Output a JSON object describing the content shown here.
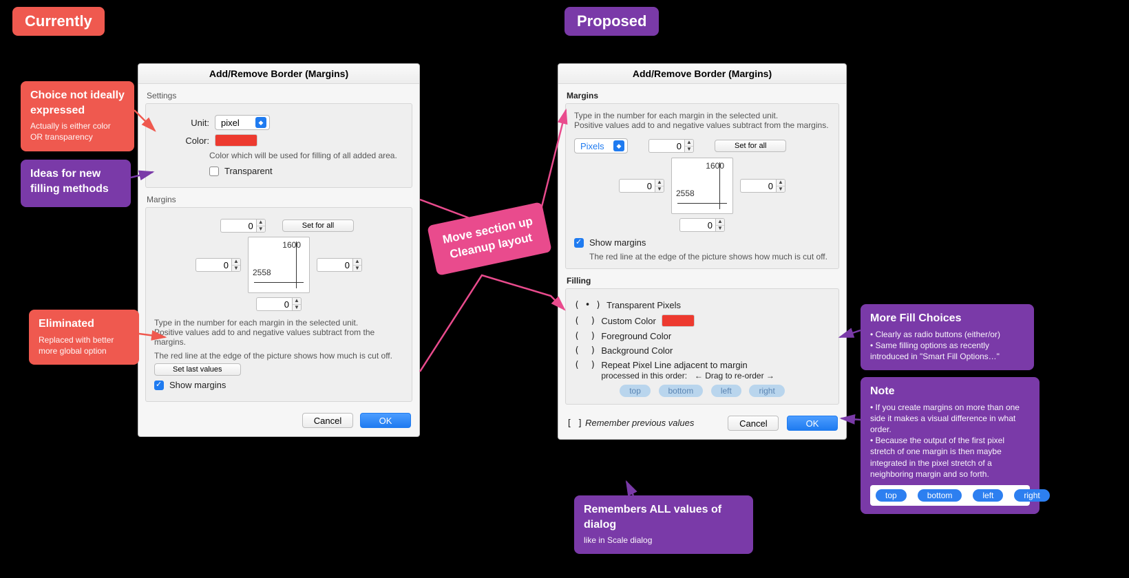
{
  "headlines": {
    "currently": "Currently",
    "proposed": "Proposed"
  },
  "callouts": {
    "choice": {
      "hd": "Choice not ideally expressed",
      "sub": "Actually is either color OR transparency"
    },
    "ideas": {
      "hd": "Ideas for new filling methods"
    },
    "eliminated": {
      "hd": "Eliminated",
      "sub": "Replaced with better more global option"
    },
    "move": {
      "l1": "Move section up",
      "l2": "Cleanup layout"
    },
    "morefill": {
      "hd": "More Fill Choices",
      "b1": "• Clearly as radio buttons (either/or)",
      "b2": "• Same filling options as recently",
      "b3": "  introduced in \"Smart Fill Options…\""
    },
    "note": {
      "hd": "Note",
      "p1": "• If you create margins on more than one side it makes a visual difference in what order.",
      "p2": "• Because the output of the first pixel stretch of one margin is then maybe integrated in the pixel stretch of a neighboring margin and so forth.",
      "chips": [
        "top",
        "bottom",
        "left",
        "right"
      ]
    },
    "remembers": {
      "hd": "Remembers ALL values of dialog",
      "sub": "like in Scale dialog"
    }
  },
  "current": {
    "title": "Add/Remove Border (Margins)",
    "settings_label": "Settings",
    "unit_label": "Unit:",
    "unit_value": "pixel",
    "color_label": "Color:",
    "color_help": "Color which will be used for filling of all added area.",
    "transparent": "Transparent",
    "margins_label": "Margins",
    "set_for_all": "Set for all",
    "top": "0",
    "left": "0",
    "right": "0",
    "bottom": "0",
    "dim_w": "2558",
    "dim_h": "1600",
    "help1": "Type in the number for each margin in the selected unit.",
    "help2": "Positive values add to and negative values subtract from the margins.",
    "redline": "The red line at the edge of the picture shows how much is cut off.",
    "set_last": "Set last values",
    "show_margins": "Show margins",
    "cancel": "Cancel",
    "ok": "OK"
  },
  "proposed": {
    "title": "Add/Remove Border (Margins)",
    "margins_label": "Margins",
    "help1": "Type in the number for each margin in the selected unit.",
    "help2": "Positive values add to and negative values subtract from the margins.",
    "unit_value": "Pixels",
    "top": "0",
    "left": "0",
    "right": "0",
    "bottom": "0",
    "dim_w": "2558",
    "dim_h": "1600",
    "set_for_all": "Set for all",
    "show_margins": "Show margins",
    "redline": "The red line at the edge of the picture shows how much is cut off.",
    "filling_label": "Filling",
    "r1": "Transparent Pixels",
    "r2": "Custom Color",
    "r3": "Foreground Color",
    "r4": "Background Color",
    "r5": "Repeat Pixel Line adjacent to margin",
    "r5b": "processed in this order:",
    "r5c": "←  Drag to re-order  →",
    "chips": [
      "top",
      "bottom",
      "left",
      "right"
    ],
    "remember": "Remember previous values",
    "cancel": "Cancel",
    "ok": "OK"
  }
}
